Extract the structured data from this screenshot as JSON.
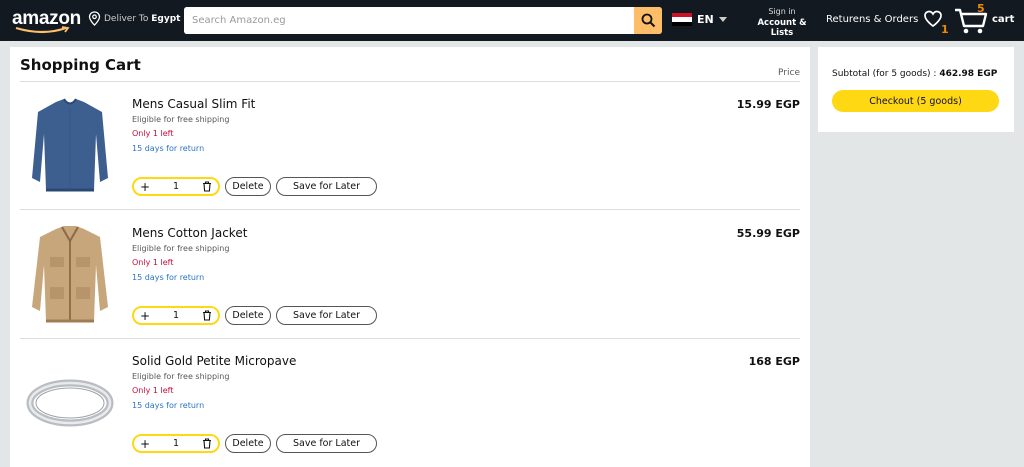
{
  "header": {
    "logo": "amazon",
    "deliver_prefix": "Deliver To",
    "deliver_location": "Egypt",
    "search_placeholder": "Search Amazon.eg",
    "language": "EN",
    "signin_line1": "Sign in",
    "signin_line2": "Account & Lists",
    "returns": "Returens & Orders",
    "wishlist_count": "1",
    "cart_count": "5",
    "cart_label": "cart",
    "colors": {
      "bar": "#131921",
      "search_button": "#febd69",
      "accent": "#f08804"
    }
  },
  "cart": {
    "title": "Shopping Cart",
    "price_header": "Price",
    "items": [
      {
        "title": "Mens Casual Slim Fit",
        "shipping": "Eligible for free shipping",
        "stock": "Only 1 left",
        "returns": "15 days for return",
        "price": "15.99 EGP",
        "qty": "1",
        "qty_plus": "+",
        "delete_label": "Delete",
        "save_label": "Save for Later",
        "image": "blue-sweater"
      },
      {
        "title": "Mens Cotton Jacket",
        "shipping": "Eligible for free shipping",
        "stock": "Only 1 left",
        "returns": "15 days for return",
        "price": "55.99 EGP",
        "qty": "1",
        "qty_plus": "+",
        "delete_label": "Delete",
        "save_label": "Save for Later",
        "image": "tan-jacket"
      },
      {
        "title": "Solid Gold Petite Micropave",
        "shipping": "Eligible for free shipping",
        "stock": "Only 1 left",
        "returns": "15 days for return",
        "price": "168 EGP",
        "qty": "1",
        "qty_plus": "+",
        "delete_label": "Delete",
        "save_label": "Save for Later",
        "image": "silver-ring"
      }
    ]
  },
  "summary": {
    "subtotal_label": "Subtotal (for 5 goods) :",
    "subtotal_value": "462.98 EGP",
    "checkout_label": "Checkout (5 goods)",
    "checkout_color": "#ffd814"
  }
}
